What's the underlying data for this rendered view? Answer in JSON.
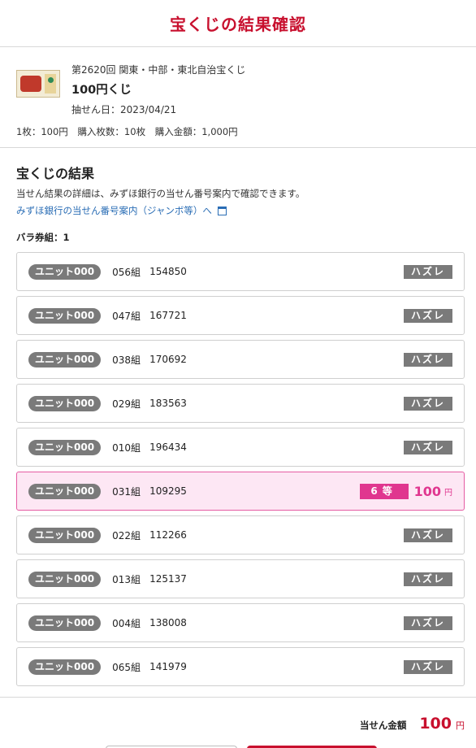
{
  "header": {
    "title": "宝くじの結果確認"
  },
  "ticket": {
    "issue": "第2620回 関東・中部・東北自治宝くじ",
    "name": "100円くじ",
    "draw_date": "抽せん日：2023/04/21",
    "price": "1枚：100円",
    "count": "購入枚数：10枚",
    "total": "購入金額：1,000円"
  },
  "results": {
    "title": "宝くじの結果",
    "note": "当せん結果の詳細は、みずほ銀行の当せん番号案内で確認できます。",
    "link": "みずほ銀行の当せん番号案内（ジャンボ等）へ",
    "bara": "バラ券組：1",
    "rows": [
      {
        "unit": "ユニット000",
        "kumi": "056組",
        "number": "154850",
        "status": "ハズレ"
      },
      {
        "unit": "ユニット000",
        "kumi": "047組",
        "number": "167721",
        "status": "ハズレ"
      },
      {
        "unit": "ユニット000",
        "kumi": "038組",
        "number": "170692",
        "status": "ハズレ"
      },
      {
        "unit": "ユニット000",
        "kumi": "029組",
        "number": "183563",
        "status": "ハズレ"
      },
      {
        "unit": "ユニット000",
        "kumi": "010組",
        "number": "196434",
        "status": "ハズレ"
      },
      {
        "unit": "ユニット000",
        "kumi": "031組",
        "number": "109295",
        "prize": "6等",
        "amount": "100",
        "yen": "円",
        "win": true
      },
      {
        "unit": "ユニット000",
        "kumi": "022組",
        "number": "112266",
        "status": "ハズレ"
      },
      {
        "unit": "ユニット000",
        "kumi": "013組",
        "number": "125137",
        "status": "ハズレ"
      },
      {
        "unit": "ユニット000",
        "kumi": "004組",
        "number": "138008",
        "status": "ハズレ"
      },
      {
        "unit": "ユニット000",
        "kumi": "065組",
        "number": "141979",
        "status": "ハズレ"
      }
    ]
  },
  "footer": {
    "total_label": "当せん金額",
    "total_value": "100",
    "total_unit": "円"
  },
  "colors": {
    "brand_red": "#c8102e",
    "win_pink": "#e0368f",
    "win_bg": "#fde7f4",
    "badge_grey": "#7a7a7a",
    "link_blue": "#2a6db5"
  },
  "icons": {
    "ticket_thumbnail": "ticket-thumbnail-icon",
    "new_window": "new-window-icon"
  }
}
